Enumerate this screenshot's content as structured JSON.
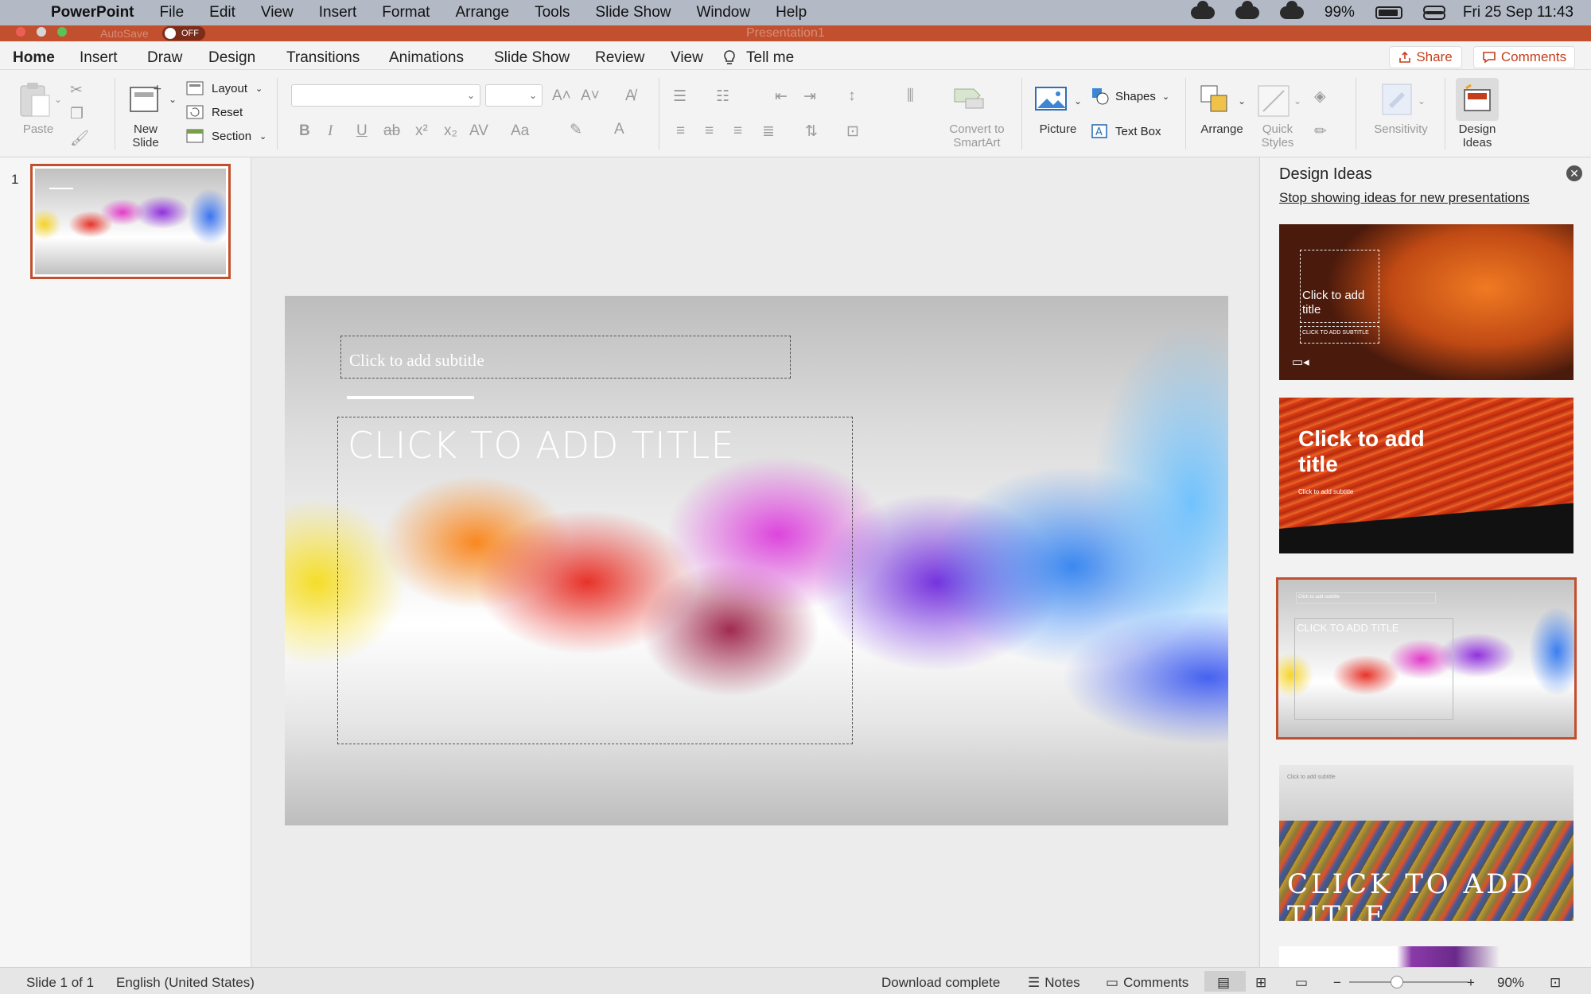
{
  "menubar": {
    "app": "PowerPoint",
    "items": [
      "File",
      "Edit",
      "View",
      "Insert",
      "Format",
      "Arrange",
      "Tools",
      "Slide Show",
      "Window",
      "Help"
    ],
    "battery": "99%",
    "datetime": "Fri 25 Sep  11:43"
  },
  "titlebar": {
    "autosave_label": "AutoSave",
    "autosave_state": "OFF",
    "doc_title": "Presentation1"
  },
  "tabs": [
    "Home",
    "Insert",
    "Draw",
    "Design",
    "Transitions",
    "Animations",
    "Slide Show",
    "Review",
    "View"
  ],
  "tell_me": "Tell me",
  "share_label": "Share",
  "comments_label": "Comments",
  "ribbon": {
    "paste": "Paste",
    "new_slide_1": "New",
    "new_slide_2": "Slide",
    "layout": "Layout",
    "reset": "Reset",
    "section": "Section",
    "convert_1": "Convert to",
    "convert_2": "SmartArt",
    "picture": "Picture",
    "shapes": "Shapes",
    "textbox": "Text Box",
    "arrange": "Arrange",
    "quick_1": "Quick",
    "quick_2": "Styles",
    "sensitivity": "Sensitivity",
    "design_ideas_1": "Design",
    "design_ideas_2": "Ideas"
  },
  "thumbnails": [
    {
      "number": "1"
    }
  ],
  "slide": {
    "subtitle_placeholder": "Click to add subtitle",
    "title_placeholder": "CLICK TO ADD TITLE"
  },
  "design_ideas": {
    "title": "Design Ideas",
    "stop_link": "Stop showing ideas for new presentations",
    "ideas": [
      {
        "title": "Click to add title",
        "subtitle": "CLICK TO ADD SUBTITLE"
      },
      {
        "title": "Click to add title",
        "subtitle": "Click to add subtitle"
      },
      {
        "title": "CLICK TO ADD TITLE",
        "subtitle": "Click to add subtitle"
      },
      {
        "title": "CLICK TO ADD TITLE",
        "subtitle": "Click to add subtitle"
      }
    ]
  },
  "status": {
    "slide_of": "Slide 1 of 1",
    "language": "English (United States)",
    "download": "Download complete",
    "notes": "Notes",
    "comments": "Comments",
    "zoom": "90%"
  },
  "colors": {
    "accent": "#c43e1c",
    "titlebar": "#c24f2e"
  }
}
